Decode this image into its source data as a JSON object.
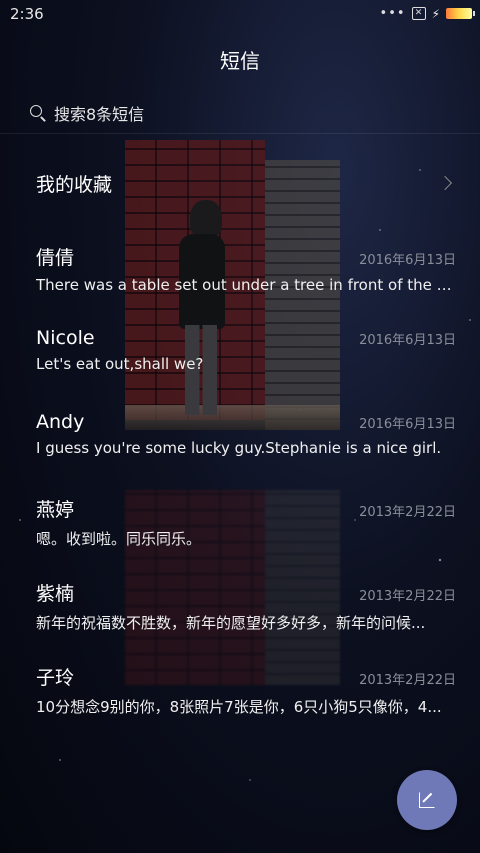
{
  "status_bar": {
    "time": "2:36",
    "icons": [
      "more-dots-icon",
      "x-box-icon",
      "charging-bolt-icon",
      "battery-icon"
    ],
    "battery_color": "#ffd84a"
  },
  "header": {
    "title": "短信"
  },
  "search": {
    "placeholder": "搜索8条短信"
  },
  "favorites": {
    "label": "我的收藏"
  },
  "messages": [
    {
      "name": "倩倩",
      "date": "2016年6月13日",
      "preview": "There was a table set out under a tree in front of the ho..."
    },
    {
      "name": "Nicole",
      "date": "2016年6月13日",
      "preview": "Let's eat out,shall we?"
    },
    {
      "name": "Andy",
      "date": "2016年6月13日",
      "preview": "I guess you're some lucky guy.Stephanie is a nice girl."
    },
    {
      "name": "燕婷",
      "date": "2013年2月22日",
      "preview": "嗯。收到啦。同乐同乐。"
    },
    {
      "name": "紫楠",
      "date": "2013年2月22日",
      "preview": "新年的祝福数不胜数，新年的愿望好多好多，新年的问候..."
    },
    {
      "name": "子玲",
      "date": "2013年2月22日",
      "preview": "10分想念9别的你，8张照片7张是你，6只小狗5只像你，4..."
    }
  ],
  "fab": {
    "icon": "compose-icon",
    "color": "#6f79b8"
  }
}
